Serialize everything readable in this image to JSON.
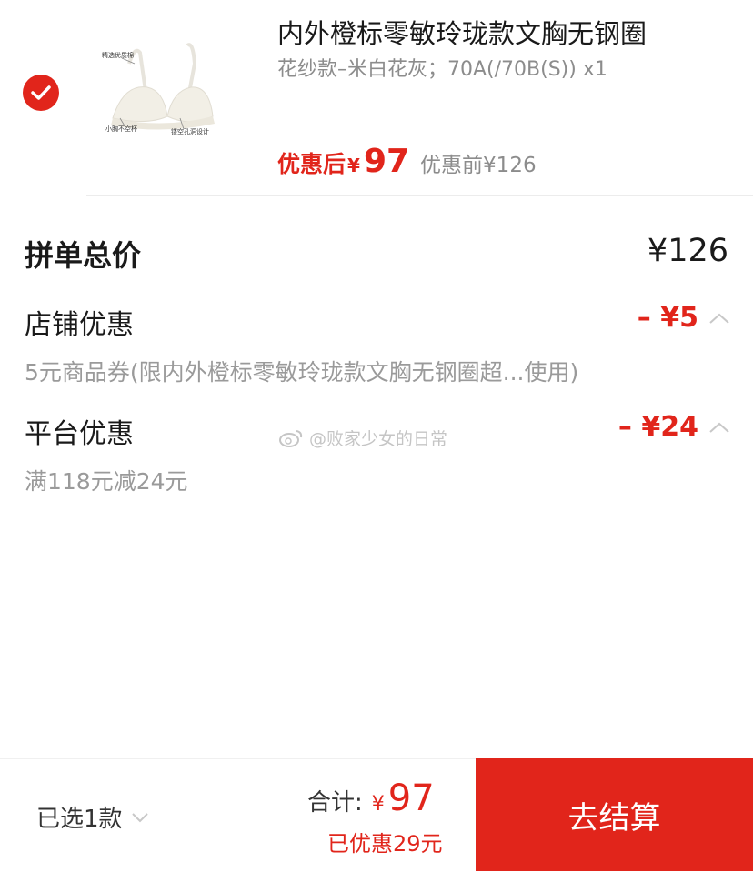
{
  "product": {
    "title": "内外橙标零敏玲珑款文胸无钢圈",
    "spec": "花纱款–米白花灰；70A(/70B(S)) x1",
    "image_labels": [
      "精选优质棉",
      "小胸不空杯",
      "镂空孔洞设计"
    ],
    "price_after_label": "优惠后",
    "price_after_currency": "¥",
    "price_after_value": "97",
    "price_before": "优惠前¥126",
    "selected": true
  },
  "summary": {
    "total_label": "拼单总价",
    "total_value": "¥126",
    "shop_discount": {
      "label": "店铺优惠",
      "value": "– ¥5",
      "desc": "5元商品券(限内外橙标零敏玲珑款文胸无钢圈超...使用)"
    },
    "platform_discount": {
      "label": "平台优惠",
      "value": "– ¥24",
      "desc": "满118元减24元"
    }
  },
  "watermark": "@败家少女的日常",
  "bottom": {
    "selected_count": "已选1款",
    "sum_label": "合计:",
    "sum_currency": "¥",
    "sum_value": "97",
    "saved": "已优惠29元",
    "checkout": "去结算"
  },
  "colors": {
    "accent": "#e1251b",
    "muted": "#8c8c8c"
  }
}
